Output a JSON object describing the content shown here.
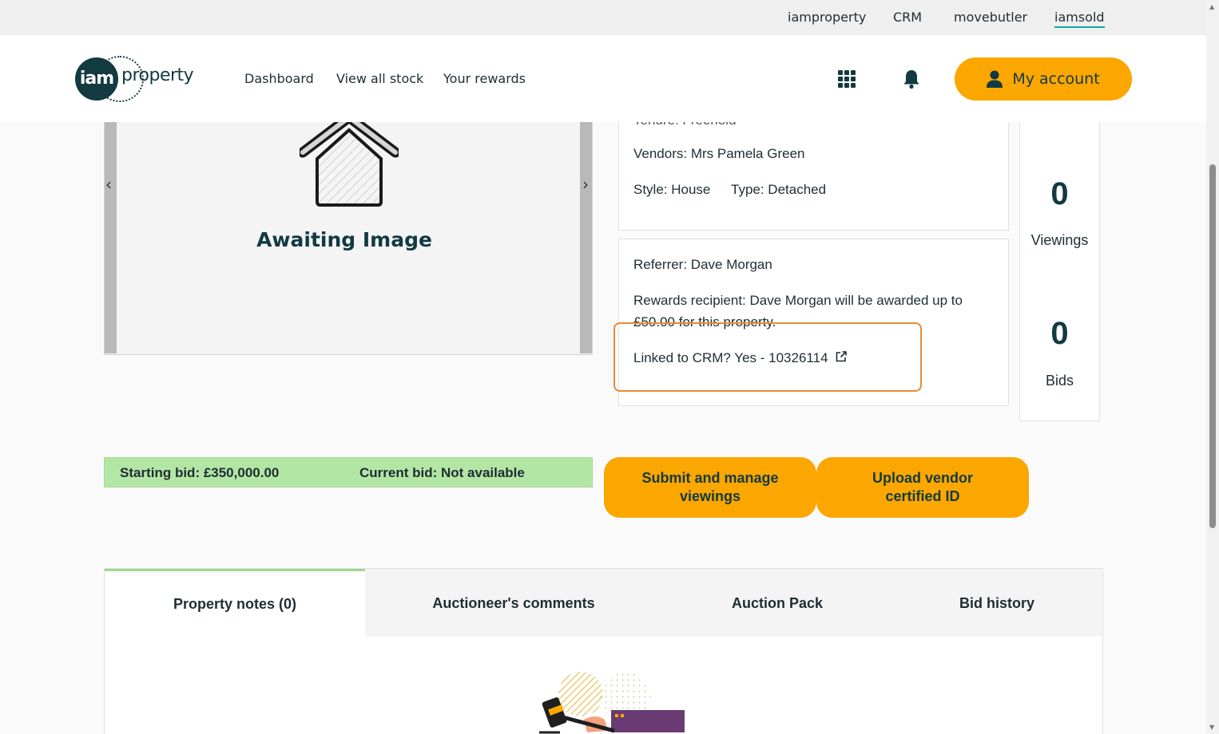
{
  "brand_bar": {
    "links": [
      "iamproperty",
      "CRM",
      "movebutler",
      "iamsold"
    ],
    "active": "iamsold"
  },
  "header": {
    "logo_word": "property",
    "logo_circle": "iam",
    "nav": [
      "Dashboard",
      "View all stock",
      "Your rewards"
    ],
    "account_label": "My account",
    "icons": [
      "apps-grid-icon",
      "bell-icon",
      "user-icon"
    ]
  },
  "gallery": {
    "placeholder_text": "Awaiting Image",
    "prev_arrow": "‹",
    "next_arrow": "›"
  },
  "details": {
    "tenure_clip": "Tenure: Freehold",
    "vendors": "Vendors: Mrs Pamela Green",
    "style": "Style: House",
    "type": "Type: Detached"
  },
  "referral": {
    "referrer": "Referrer: Dave Morgan",
    "rewards_line1": "Rewards recipient: Dave Morgan will be awarded up to",
    "rewards_line2": "£50.00 for this property.",
    "crm_linked": "Linked to CRM? Yes - 10326114"
  },
  "stats": {
    "viewings_count": "0",
    "viewings_label": "Viewings",
    "bids_count": "0",
    "bids_label": "Bids"
  },
  "bidding": {
    "starting_bid": "Starting bid: £350,000.00",
    "current_bid": "Current bid: Not available"
  },
  "actions": {
    "viewings_button": "Submit and manage viewings",
    "vendor_id_button": "Upload vendor certified ID"
  },
  "tabs": [
    "Property notes (0)",
    "Auctioneer's comments",
    "Auction Pack",
    "Bid history"
  ],
  "colors": {
    "accent": "#fca600",
    "brand_dark": "#123a40",
    "bid_bar": "#b3e6a4",
    "highlight": "#e88a3a"
  }
}
